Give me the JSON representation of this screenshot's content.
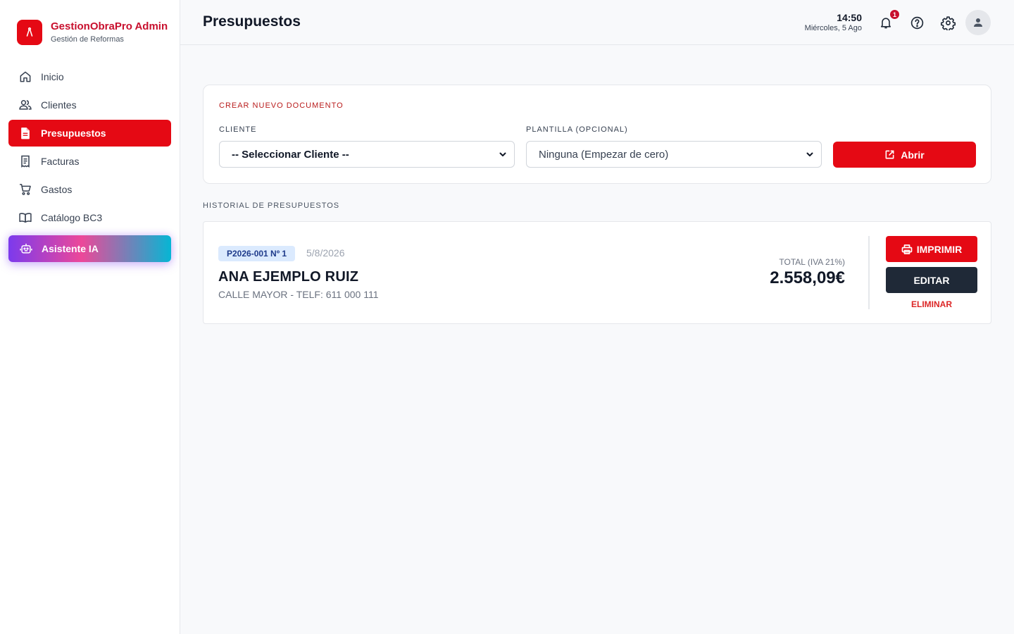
{
  "colors": {
    "brand": "#e50914",
    "brand_text": "#c8102e",
    "dark_button": "#1f2937",
    "badge_bg": "#dbeafe"
  },
  "brand": {
    "title": "GestionObraPro Admin",
    "subtitle": "Gestión de Reformas",
    "logo_icon": "compass-icon"
  },
  "sidebar": {
    "items": [
      {
        "label": "Inicio",
        "icon": "home-icon",
        "active": false
      },
      {
        "label": "Clientes",
        "icon": "users-icon",
        "active": false
      },
      {
        "label": "Presupuestos",
        "icon": "document-icon",
        "active": true
      },
      {
        "label": "Facturas",
        "icon": "receipt-icon",
        "active": false
      },
      {
        "label": "Gastos",
        "icon": "cart-icon",
        "active": false
      },
      {
        "label": "Catálogo BC3",
        "icon": "book-icon",
        "active": false
      },
      {
        "label": "Asistente IA",
        "icon": "robot-icon",
        "active": false
      }
    ]
  },
  "header": {
    "title": "Presupuestos",
    "time": "14:50",
    "date": "Miércoles, 5 Ago",
    "notifications_count": "1"
  },
  "create": {
    "section_title": "CREAR NUEVO DOCUMENTO",
    "client_label": "CLIENTE",
    "client_value": "-- Seleccionar Cliente --",
    "template_label": "PLANTILLA (OPCIONAL)",
    "template_value": "Ninguna (Empezar de cero)",
    "open_button": "Abrir"
  },
  "history": {
    "section_title": "HISTORIAL DE PRESUPUESTOS",
    "items": [
      {
        "code": "P2026-001 Nº 1",
        "date": "5/8/2026",
        "client": "ANA EJEMPLO RUIZ",
        "detail": "CALLE MAYOR - TELF: 611 000 111",
        "total_label": "TOTAL (IVA 21%)",
        "total": "2.558,09€",
        "print_button": "IMPRIMIR",
        "edit_button": "EDITAR",
        "delete_button": "ELIMINAR"
      }
    ]
  }
}
